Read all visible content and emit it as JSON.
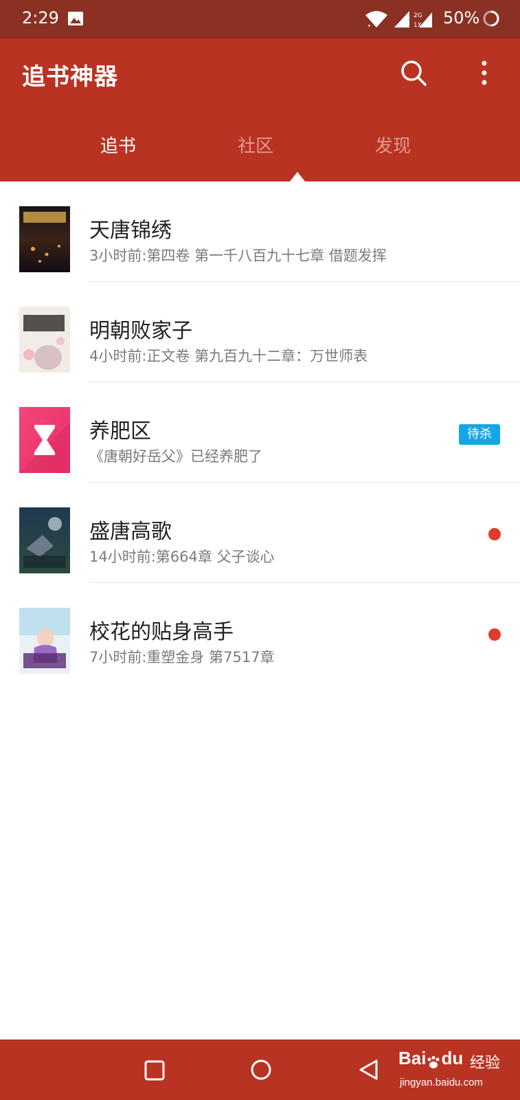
{
  "status_bar": {
    "time": "2:29",
    "battery": "50%",
    "network_top": "2G",
    "network_bottom": "1X",
    "icons": [
      "image-icon",
      "wifi-icon",
      "signal-icon",
      "signal-2g-icon",
      "battery-icon"
    ]
  },
  "app_bar": {
    "title": "追书神器",
    "icons": [
      "search-icon",
      "more-vert-icon"
    ],
    "tabs": [
      {
        "label": "追书",
        "active": true
      },
      {
        "label": "社区",
        "active": false
      },
      {
        "label": "发现",
        "active": false
      }
    ]
  },
  "books": [
    {
      "title": "天唐锦绣",
      "subtitle": "3小时前:第四卷 第一千八百九十七章 借题发挥"
    },
    {
      "title": "明朝败家子",
      "subtitle": "4小时前:正文卷 第九百九十二章：万世师表"
    },
    {
      "title": "养肥区",
      "subtitle": "《唐朝好岳父》已经养肥了",
      "badge": "待杀"
    },
    {
      "title": "盛唐高歌",
      "subtitle": "14小时前:第664章 父子谈心",
      "unread_dot": true
    },
    {
      "title": "校花的贴身高手",
      "subtitle": "7小时前:重塑金身 第7517章",
      "unread_dot": true
    }
  ],
  "nav_bar": {
    "icons": [
      "recent-apps-icon",
      "home-icon",
      "back-icon"
    ]
  },
  "watermark": {
    "brand": "Bai",
    "brand_tail": "du",
    "label": "经验",
    "url": "jingyan.baidu.com"
  },
  "colors": {
    "status_bar": "#8a3123",
    "app_bar": "#b93322",
    "badge": "#16a6e6",
    "unread_dot": "#e03a2b"
  }
}
